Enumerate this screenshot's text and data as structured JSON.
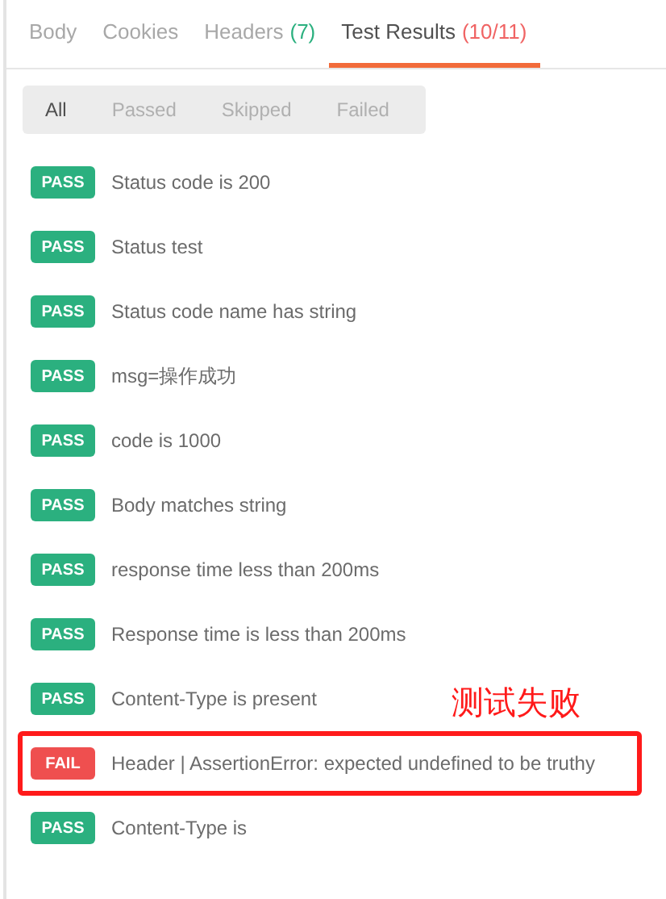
{
  "tabs": [
    {
      "label": "Body",
      "selected": false
    },
    {
      "label": "Cookies",
      "selected": false
    },
    {
      "label": "Headers",
      "count": "(7)",
      "color": "#2bb07f",
      "selected": false
    },
    {
      "label": "Test Results",
      "count": "(10/11)",
      "color": "#f06464",
      "selected": true
    }
  ],
  "filters": [
    {
      "label": "All",
      "selected": true
    },
    {
      "label": "Passed",
      "selected": false
    },
    {
      "label": "Skipped",
      "selected": false
    },
    {
      "label": "Failed",
      "selected": false
    }
  ],
  "tests": [
    {
      "kind": "pass",
      "badge": "PASS",
      "name": "Status code is 200",
      "highlighted": false
    },
    {
      "kind": "pass",
      "badge": "PASS",
      "name": "Status test",
      "highlighted": false
    },
    {
      "kind": "pass",
      "badge": "PASS",
      "name": "Status code name has string",
      "highlighted": false
    },
    {
      "kind": "pass",
      "badge": "PASS",
      "name": "msg=操作成功",
      "highlighted": false
    },
    {
      "kind": "pass",
      "badge": "PASS",
      "name": "code is 1000",
      "highlighted": false
    },
    {
      "kind": "pass",
      "badge": "PASS",
      "name": "Body matches string",
      "highlighted": false
    },
    {
      "kind": "pass",
      "badge": "PASS",
      "name": "response time less than 200ms",
      "highlighted": false
    },
    {
      "kind": "pass",
      "badge": "PASS",
      "name": "Response time is less than 200ms",
      "highlighted": false
    },
    {
      "kind": "pass",
      "badge": "PASS",
      "name": "Content-Type is present",
      "highlighted": false
    },
    {
      "kind": "fail",
      "badge": "FAIL",
      "name": "Header | AssertionError: expected undefined to be truthy",
      "highlighted": true
    },
    {
      "kind": "pass",
      "badge": "PASS",
      "name": "Content-Type is",
      "highlighted": false
    }
  ],
  "annotation": "测试失败"
}
